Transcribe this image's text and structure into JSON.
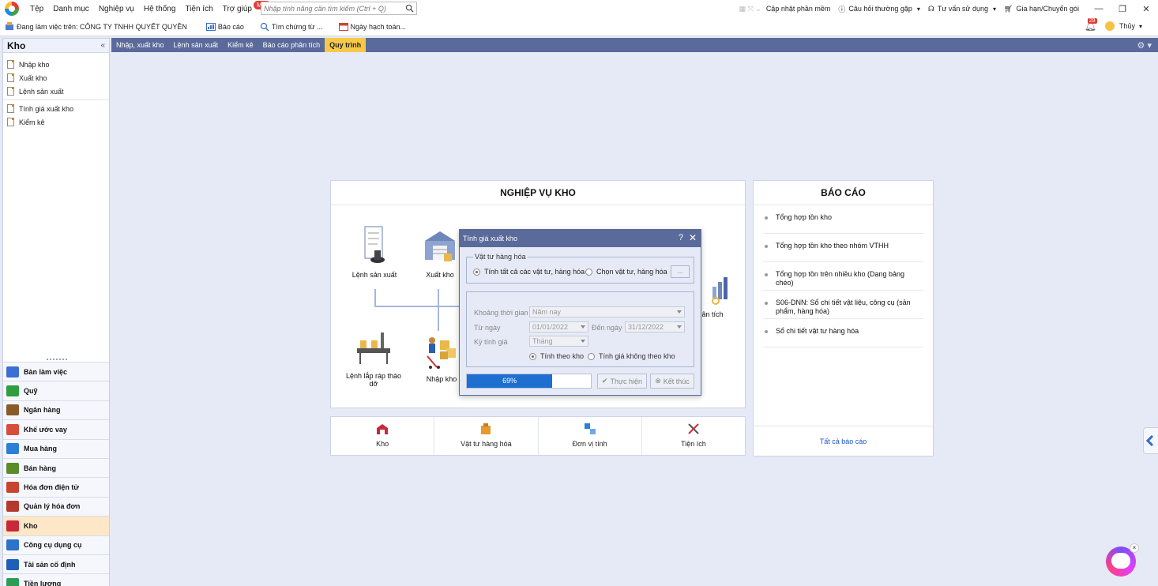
{
  "menubar": {
    "items": [
      "Tệp",
      "Danh mục",
      "Nghiệp vụ",
      "Hệ thống",
      "Tiện ích",
      "Trợ giúp"
    ],
    "new_badge": "Mới",
    "search_placeholder": "Nhập tính năng cần tìm kiếm (Ctrl + Q)",
    "update": "Cập nhật phần mềm",
    "faq": "Câu hỏi thường gặp",
    "support": "Tư vấn sử dụng",
    "renew": "Gia hạn/Chuyển gói",
    "window_buttons": [
      "—",
      "❐",
      "✕"
    ]
  },
  "bar2": {
    "working_on": "Đang làm việc trên: CÔNG TY TNHH QUYẾT QUYỀN",
    "reports": "Báo cáo",
    "find_voucher": "Tìm chứng từ ...",
    "posting_date": "Ngày hạch toán...",
    "notif_count": "29",
    "user": "Thủy"
  },
  "sidebar": {
    "title": "Kho",
    "collapse": "«",
    "tree": [
      "Nhập kho",
      "Xuất kho",
      "Lệnh sản xuất",
      "Tính giá xuất kho",
      "Kiểm kê"
    ],
    "modules": [
      {
        "label": "Bàn làm việc",
        "color": "#3b6fd4"
      },
      {
        "label": "Quỹ",
        "color": "#2e9e3e"
      },
      {
        "label": "Ngân hàng",
        "color": "#8a5a2b"
      },
      {
        "label": "Khế ước vay",
        "color": "#d84c3c"
      },
      {
        "label": "Mua hàng",
        "color": "#2c7fd6"
      },
      {
        "label": "Bán hàng",
        "color": "#5b8c2a"
      },
      {
        "label": "Hóa đơn điện tử",
        "color": "#c8442f"
      },
      {
        "label": "Quản lý hóa đơn",
        "color": "#b43a2e"
      },
      {
        "label": "Kho",
        "color": "#c8283a"
      },
      {
        "label": "Công cụ dụng cụ",
        "color": "#2c73c9"
      },
      {
        "label": "Tài sản cố định",
        "color": "#1f5fb8"
      },
      {
        "label": "Tiền lương",
        "color": "#2f9b57"
      }
    ]
  },
  "tabs": [
    "Nhập, xuất kho",
    "Lệnh sản xuất",
    "Kiểm kê",
    "Báo cáo phân tích",
    "Quy trình"
  ],
  "business_panel": {
    "title": "NGHIỆP VỤ KHO",
    "flow": {
      "production_order": "Lệnh sản xuất",
      "export": "Xuất kho",
      "assembly": "Lệnh lắp ráp tháo dỡ",
      "import": "Nhập kho",
      "analysis": "o phân tích"
    }
  },
  "bottom_items": [
    "Kho",
    "Vật tư hàng hóa",
    "Đơn vị tính",
    "Tiện ích"
  ],
  "report_panel": {
    "title": "BÁO CÁO",
    "items": [
      "Tổng hợp tồn kho",
      "Tổng hợp tồn kho theo nhóm VTHH",
      "Tổng hợp tồn trên nhiều kho (Dạng bảng chéo)",
      "S06-DNN: Sổ chi tiết vật liệu, công cụ (sản phẩm, hàng hóa)",
      "Sổ chi tiết vật tư hàng hóa"
    ],
    "all": "Tất cả báo cáo"
  },
  "dialog": {
    "title": "Tính giá xuất kho",
    "help": "?",
    "close": "✕",
    "group_label": "Vật tư hàng hóa",
    "opt_all": "Tính tất cả các vật tư, hàng hóa",
    "opt_choose": "Chọn vật tư, hàng hóa",
    "ellipsis": "...",
    "period_label": "Khoảng thời gian",
    "period_value": "Năm nay",
    "from_label": "Từ ngày",
    "from_value": "01/01/2022",
    "to_label": "Đến ngày",
    "to_value": "31/12/2022",
    "cycle_label": "Kỳ tính giá",
    "cycle_value": "Tháng",
    "by_warehouse": "Tính theo kho",
    "not_by_warehouse": "Tính giá không theo kho",
    "progress": 0.69,
    "progress_label": "69%",
    "execute": "Thực hiện",
    "finish": "Kết thúc"
  }
}
